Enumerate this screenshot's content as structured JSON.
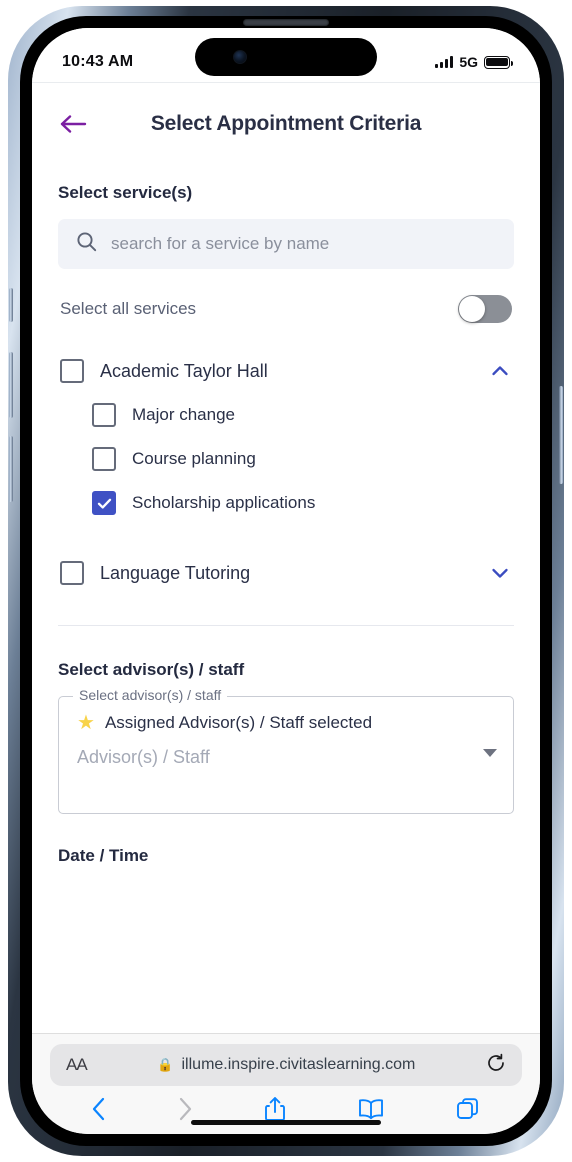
{
  "status_bar": {
    "time": "10:43 AM",
    "network": "5G",
    "signal_icon": "signal-bars-icon",
    "battery_icon": "battery-icon"
  },
  "app": {
    "back_icon": "back-arrow-icon",
    "title": "Select Appointment Criteria"
  },
  "services": {
    "section_title": "Select service(s)",
    "search": {
      "icon": "search-icon",
      "placeholder": "search for a service by name",
      "value": ""
    },
    "select_all": {
      "label": "Select all services",
      "toggle_state": "off"
    },
    "groups": [
      {
        "label": "Academic Taylor Hall",
        "checked": false,
        "expanded": true,
        "chevron_icon": "chevron-up-icon",
        "items": [
          {
            "label": "Major change",
            "checked": false
          },
          {
            "label": "Course planning",
            "checked": false
          },
          {
            "label": "Scholarship applications",
            "checked": true
          }
        ]
      },
      {
        "label": "Language Tutoring",
        "checked": false,
        "expanded": false,
        "chevron_icon": "chevron-down-icon",
        "items": []
      }
    ]
  },
  "advisors": {
    "section_title": "Select advisor(s) / staff",
    "field_legend": "Select advisor(s) / staff",
    "star_icon": "star-icon",
    "selected_text": "Assigned Advisor(s) / Staff selected",
    "placeholder": "Advisor(s) / Staff",
    "caret_icon": "dropdown-caret-icon"
  },
  "datetime": {
    "section_title": "Date / Time"
  },
  "browser": {
    "aa_label": "AA",
    "lock_icon": "lock-icon",
    "url": "illume.inspire.civitaslearning.com",
    "reload_icon": "reload-icon",
    "toolbar": {
      "back_icon": "chevron-left-icon",
      "forward_icon": "chevron-right-icon",
      "share_icon": "share-icon",
      "bookmarks_icon": "book-icon",
      "tabs_icon": "tabs-icon"
    }
  },
  "colors": {
    "accent_purple": "#7b1fa2",
    "accent_blue": "#3f51c4",
    "safari_blue": "#0a84ff",
    "star_yellow": "#f8d34a",
    "toggle_off": "#8b8f96"
  }
}
